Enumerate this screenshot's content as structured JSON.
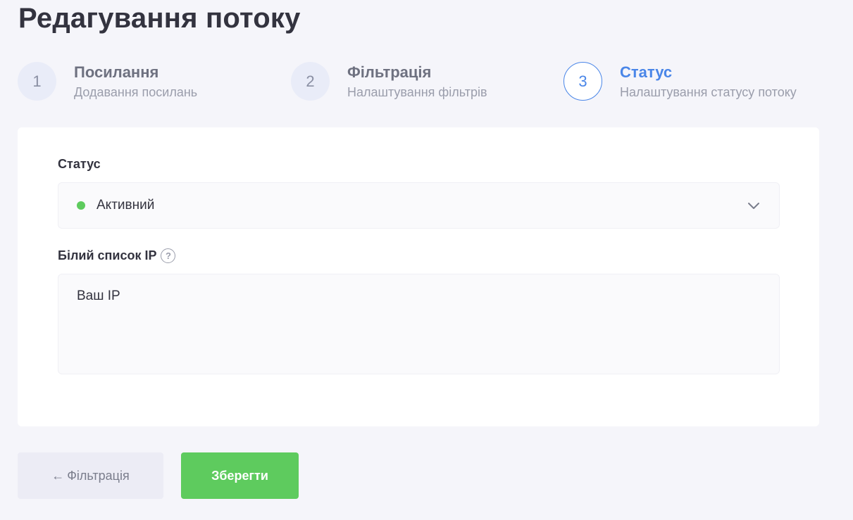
{
  "page": {
    "title": "Редагування потоку"
  },
  "stepper": {
    "steps": [
      {
        "number": "1",
        "title": "Посилання",
        "subtitle": "Додавання посилань",
        "state": "inactive"
      },
      {
        "number": "2",
        "title": "Фільтрація",
        "subtitle": "Налаштування фільтрів",
        "state": "inactive"
      },
      {
        "number": "3",
        "title": "Статус",
        "subtitle": "Налаштування статусу потоку",
        "state": "active"
      }
    ]
  },
  "form": {
    "status": {
      "label": "Статус",
      "value": "Активний",
      "dot_color": "#5ecb5e",
      "icon": "chevron-down-icon"
    },
    "ip_whitelist": {
      "label": "Білий список IP",
      "help_icon": "question-circle-icon",
      "help_glyph": "?",
      "value": "Ваш IP"
    }
  },
  "actions": {
    "back_arrow": "←",
    "back_label": "Фільтрація",
    "save_label": "Зберегти"
  },
  "colors": {
    "accent": "#4a86e8",
    "success": "#5ecb5e",
    "background": "#f5f5fa"
  }
}
